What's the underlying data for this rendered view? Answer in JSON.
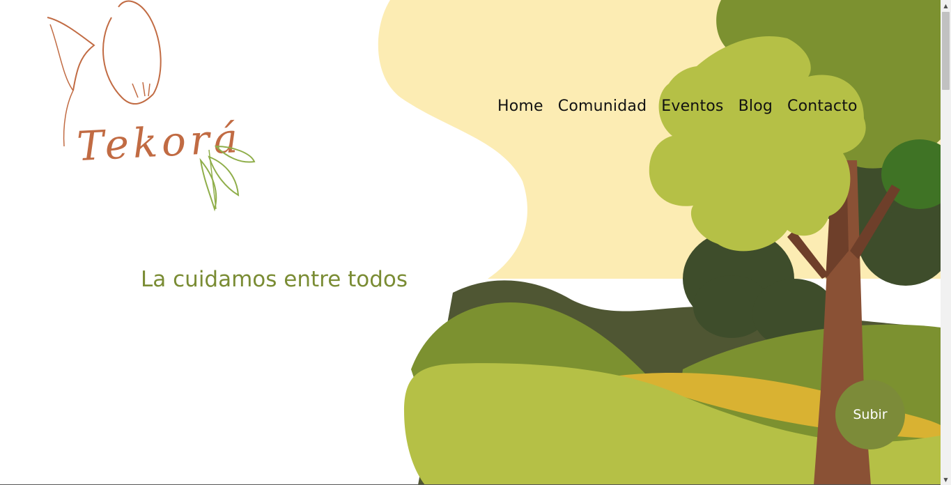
{
  "brand": {
    "logo_text": "Tekorá"
  },
  "nav": {
    "items": [
      {
        "label": "Home"
      },
      {
        "label": "Comunidad"
      },
      {
        "label": "Eventos"
      },
      {
        "label": "Blog"
      },
      {
        "label": "Contacto"
      }
    ]
  },
  "hero": {
    "tagline": "La cuidamos entre todos"
  },
  "back_to_top": {
    "label": "Subir"
  },
  "colors": {
    "cream": "#fcecb3",
    "dark_green": "#3e4d2b",
    "olive": "#7c9130",
    "lime": "#b5c046",
    "mustard": "#d9b232",
    "trunk": "#8a5135",
    "tagline": "#7a8c34",
    "button": "#7c8b39",
    "logo_brown": "#c16b43",
    "logo_leaf": "#8fae4a"
  }
}
